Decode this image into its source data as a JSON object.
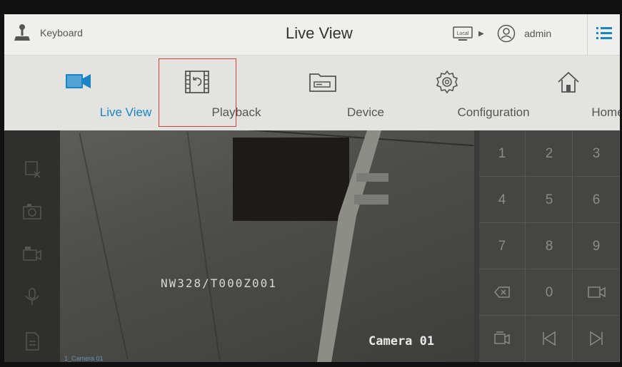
{
  "topbar": {
    "keyboard_label": "Keyboard",
    "title": "Live View",
    "local_badge": "Local",
    "user_name": "admin"
  },
  "nav": {
    "items": [
      {
        "label": "Live View",
        "icon": "camera-icon",
        "active": true
      },
      {
        "label": "Playback",
        "icon": "playback-icon",
        "active": false
      },
      {
        "label": "Device",
        "icon": "device-icon",
        "active": false
      },
      {
        "label": "Configuration",
        "icon": "gear-icon",
        "active": false
      },
      {
        "label": "Home",
        "icon": "home-icon",
        "active": false
      }
    ]
  },
  "video": {
    "overlay_text": "NW328/T000Z001",
    "camera_name": "Camera 01"
  },
  "status": {
    "channel_label": "1_Camera 01"
  },
  "keypad": {
    "keys": [
      "1",
      "2",
      "3",
      "4",
      "5",
      "6",
      "7",
      "8",
      "9",
      "",
      "0",
      ""
    ]
  },
  "colors": {
    "accent": "#1a84c7",
    "highlight_box": "#e0403a"
  }
}
